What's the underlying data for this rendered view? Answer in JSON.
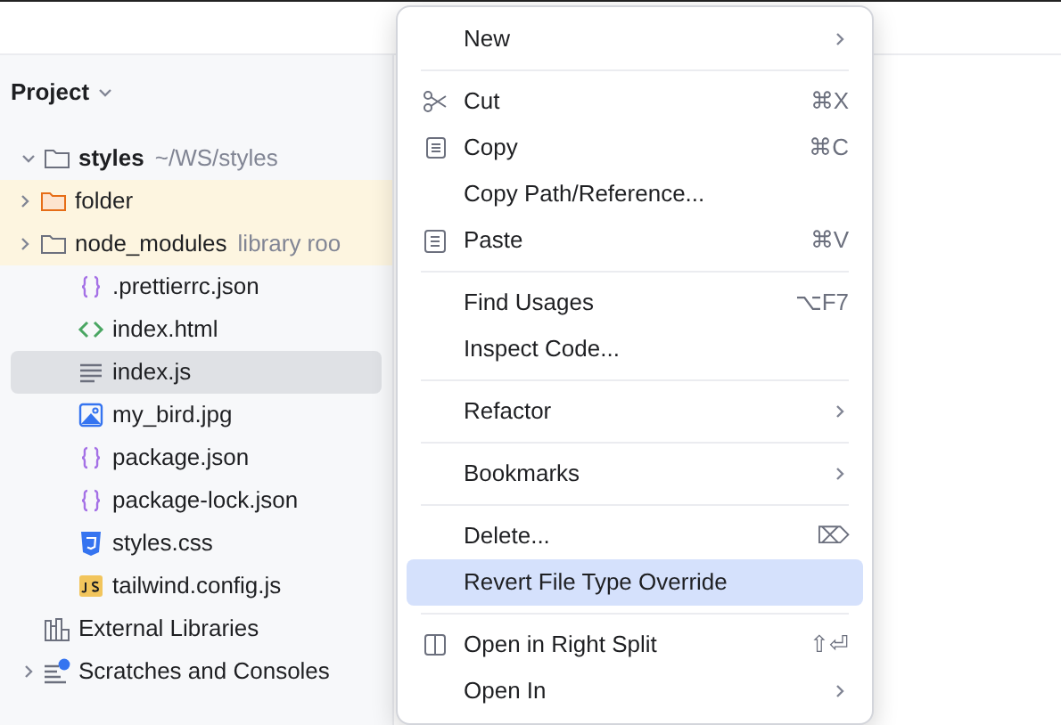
{
  "panel": {
    "title": "Project"
  },
  "tree": [
    {
      "name": "styles",
      "hint": "~/WS/styles",
      "kind": "folder",
      "bold": true,
      "expanded": true,
      "highlighted": false,
      "selected": false,
      "children": [
        {
          "name": "folder",
          "kind": "folder-excluded",
          "expanded": false,
          "highlighted": true,
          "selected": false
        },
        {
          "name": "node_modules",
          "hint": "library roo",
          "kind": "folder",
          "expanded": false,
          "highlighted": true,
          "selected": false
        },
        {
          "name": ".prettierrc.json",
          "kind": "json",
          "highlighted": false,
          "selected": false
        },
        {
          "name": "index.html",
          "kind": "html",
          "highlighted": false,
          "selected": false
        },
        {
          "name": "index.js",
          "kind": "text",
          "highlighted": false,
          "selected": true
        },
        {
          "name": "my_bird.jpg",
          "kind": "image",
          "highlighted": false,
          "selected": false
        },
        {
          "name": "package.json",
          "kind": "json",
          "highlighted": false,
          "selected": false
        },
        {
          "name": "package-lock.json",
          "kind": "json",
          "highlighted": false,
          "selected": false
        },
        {
          "name": "styles.css",
          "kind": "css",
          "highlighted": false,
          "selected": false
        },
        {
          "name": "tailwind.config.js",
          "kind": "js",
          "highlighted": false,
          "selected": false
        }
      ]
    },
    {
      "name": "External Libraries",
      "kind": "libraries",
      "highlighted": false,
      "selected": false
    },
    {
      "name": "Scratches and Consoles",
      "kind": "scratches",
      "expanded": false,
      "highlighted": false,
      "selected": false
    }
  ],
  "context_menu": [
    {
      "kind": "item",
      "label": "New",
      "submenu": true,
      "selected": false
    },
    {
      "kind": "separator"
    },
    {
      "kind": "cut",
      "label": "Cut",
      "shortcut": "⌘X",
      "selected": false
    },
    {
      "kind": "copy",
      "label": "Copy",
      "shortcut": "⌘C",
      "selected": false
    },
    {
      "kind": "item",
      "label": "Copy Path/Reference...",
      "selected": false
    },
    {
      "kind": "paste",
      "label": "Paste",
      "shortcut": "⌘V",
      "selected": false
    },
    {
      "kind": "separator"
    },
    {
      "kind": "item",
      "label": "Find Usages",
      "shortcut": "⌥F7",
      "selected": false
    },
    {
      "kind": "item",
      "label": "Inspect Code...",
      "selected": false
    },
    {
      "kind": "separator"
    },
    {
      "kind": "item",
      "label": "Refactor",
      "submenu": true,
      "selected": false
    },
    {
      "kind": "separator"
    },
    {
      "kind": "item",
      "label": "Bookmarks",
      "submenu": true,
      "selected": false
    },
    {
      "kind": "separator"
    },
    {
      "kind": "item",
      "label": "Delete...",
      "shortcut": "⌦",
      "selected": false
    },
    {
      "kind": "item",
      "label": "Revert File Type Override",
      "selected": true
    },
    {
      "kind": "separator"
    },
    {
      "kind": "split",
      "label": "Open in Right Split",
      "shortcut": "⇧⏎",
      "selected": false
    },
    {
      "kind": "item",
      "label": "Open In",
      "submenu": true,
      "selected": false
    }
  ]
}
